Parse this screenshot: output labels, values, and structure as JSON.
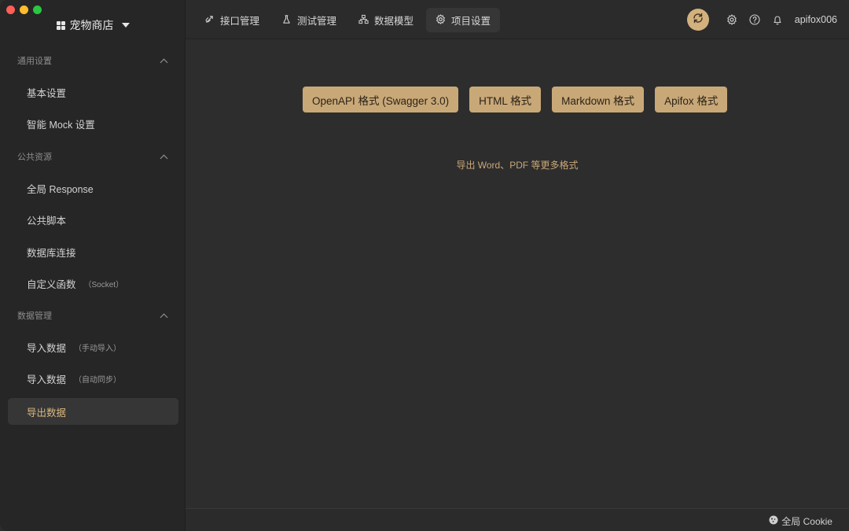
{
  "project": {
    "name": "宠物商店"
  },
  "sidebar": {
    "groups": [
      {
        "title": "通用设置",
        "items": [
          {
            "label": "基本设置",
            "sub": ""
          },
          {
            "label": "智能 Mock 设置",
            "sub": ""
          }
        ]
      },
      {
        "title": "公共资源",
        "items": [
          {
            "label": "全局 Response",
            "sub": ""
          },
          {
            "label": "公共脚本",
            "sub": ""
          },
          {
            "label": "数据库连接",
            "sub": ""
          },
          {
            "label": "自定义函数",
            "sub": "（Socket）"
          }
        ]
      },
      {
        "title": "数据管理",
        "items": [
          {
            "label": "导入数据",
            "sub": "（手动导入）"
          },
          {
            "label": "导入数据",
            "sub": "（自动同步）"
          },
          {
            "label": "导出数据",
            "sub": ""
          }
        ]
      }
    ],
    "active_item": "导出数据"
  },
  "topbar": {
    "tabs": [
      {
        "label": "接口管理",
        "icon": "link-icon"
      },
      {
        "label": "测试管理",
        "icon": "flask-icon"
      },
      {
        "label": "数据模型",
        "icon": "model-icon"
      },
      {
        "label": "项目设置",
        "icon": "gear-icon"
      }
    ],
    "active_tab": "项目设置",
    "username": "apifox006"
  },
  "main": {
    "formats": [
      "OpenAPI 格式 (Swagger 3.0)",
      "HTML 格式",
      "Markdown 格式",
      "Apifox 格式"
    ],
    "more_link": "导出 Word、PDF 等更多格式"
  },
  "statusbar": {
    "cookie_label": "全局 Cookie"
  },
  "colors": {
    "accent": "#c9a878",
    "sync": "#d2b17d",
    "background": "#2d2d2d",
    "sidebar": "#262626"
  }
}
